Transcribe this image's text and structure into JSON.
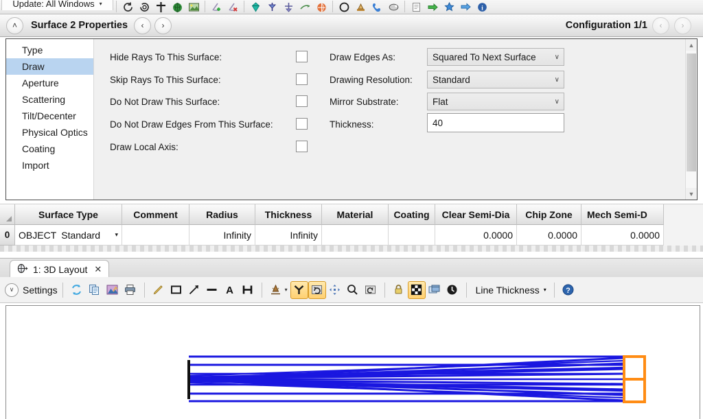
{
  "top_toolbar": {
    "update_label": "Update: All Windows",
    "caret": "▾",
    "icons": [
      "refresh-clockwise-icon",
      "refresh-counter-icon",
      "crosshair-icon",
      "globe-icon",
      "image-icon",
      "insert-surface-icon",
      "delete-surface-icon",
      "gem-icon",
      "fold-mirror-icon",
      "coordinate-break-icon",
      "ray-aim-icon",
      "color-globe-icon",
      "lens-catalog-icon",
      "tolerance-icon",
      "phone-icon",
      "ellipse-icon",
      "report-icon",
      "green-arrow-icon",
      "blue-star-icon",
      "blue-arrow-icon",
      "help-info-icon"
    ]
  },
  "prop_header": {
    "collapse_icon": "˄",
    "title": "Surface   2 Properties",
    "prev_icon": "‹",
    "next_icon": "›",
    "config_label": "Configuration 1/1"
  },
  "categories": {
    "items": [
      {
        "label": "Type",
        "active": false
      },
      {
        "label": "Draw",
        "active": true
      },
      {
        "label": "Aperture",
        "active": false
      },
      {
        "label": "Scattering",
        "active": false
      },
      {
        "label": "Tilt/Decenter",
        "active": false
      },
      {
        "label": "Physical Optics",
        "active": false
      },
      {
        "label": "Coating",
        "active": false
      },
      {
        "label": "Import",
        "active": false
      }
    ]
  },
  "draw_form": {
    "checkboxes": [
      {
        "label": "Hide Rays To This Surface:",
        "checked": false
      },
      {
        "label": "Skip Rays To This Surface:",
        "checked": false
      },
      {
        "label": "Do Not Draw This Surface:",
        "checked": false
      },
      {
        "label": "Do Not Draw Edges From This Surface:",
        "checked": false
      },
      {
        "label": "Draw Local Axis:",
        "checked": false
      }
    ],
    "fields": [
      {
        "label": "Draw Edges As:",
        "value": "Squared To Next Surface",
        "kind": "dropdown"
      },
      {
        "label": "Drawing Resolution:",
        "value": "Standard",
        "kind": "dropdown"
      },
      {
        "label": "Mirror Substrate:",
        "value": "Flat",
        "kind": "dropdown"
      },
      {
        "label": "Thickness:",
        "value": "40",
        "kind": "text"
      }
    ],
    "chevron": "∨"
  },
  "scrollbar": {
    "up_icon": "▲",
    "down_icon": "▼"
  },
  "sheet": {
    "columns": [
      {
        "label": "Surface Type",
        "width": 156
      },
      {
        "label": "Comment",
        "width": 98
      },
      {
        "label": "Radius",
        "width": 96
      },
      {
        "label": "Thickness",
        "width": 97
      },
      {
        "label": "Material",
        "width": 97
      },
      {
        "label": "Coating",
        "width": 68
      },
      {
        "label": "Clear Semi-Dia",
        "width": 119
      },
      {
        "label": "Chip Zone",
        "width": 94
      },
      {
        "label": "Mech Semi-D",
        "width": 120
      }
    ],
    "row": {
      "index": "0",
      "surface_prefix": "OBJECT",
      "surface_type": "Standard",
      "caret": "▾",
      "comment": "",
      "radius": "Infinity",
      "thickness": "Infinity",
      "material": "",
      "coating": "",
      "clear_semi_dia": "0.0000",
      "chip_zone": "0.0000",
      "mech_semi_dia": "0.0000"
    }
  },
  "window_tab": {
    "label": "1: 3D Layout",
    "close_icon": "✕",
    "icon": "lens-3d-icon"
  },
  "layout_toolbar": {
    "settings_label": "Settings",
    "settings_caret": "∨",
    "line_thickness_label": "Line Thickness",
    "line_thickness_caret": "▾",
    "icons": [
      {
        "name": "refresh-icon",
        "active": false
      },
      {
        "name": "copy-icon",
        "active": false
      },
      {
        "name": "save-image-icon",
        "active": false
      },
      {
        "name": "print-icon",
        "active": false
      },
      {
        "name": "pencil-icon",
        "active": false
      },
      {
        "name": "rectangle-icon",
        "active": false
      },
      {
        "name": "arrow-icon",
        "active": false
      },
      {
        "name": "line-icon",
        "active": false
      },
      {
        "name": "text-tool-icon",
        "active": false
      },
      {
        "name": "dimension-icon",
        "active": false
      },
      {
        "name": "annotation-dropdown-icon",
        "active": false
      },
      {
        "name": "axis-3d-icon",
        "active": true
      },
      {
        "name": "rotate-icon",
        "active": true
      },
      {
        "name": "pan-icon",
        "active": false
      },
      {
        "name": "zoom-icon",
        "active": false
      },
      {
        "name": "reset-view-icon",
        "active": false
      },
      {
        "name": "lock-icon",
        "active": false
      },
      {
        "name": "fit-window-icon",
        "active": true
      },
      {
        "name": "window-layers-icon",
        "active": false
      },
      {
        "name": "clock-icon",
        "active": false
      },
      {
        "name": "help-icon",
        "active": false
      }
    ]
  },
  "plot": {
    "ray_color": "#1a17e0",
    "detector_color": "#ff8c14",
    "object_line_color": "#111111",
    "background": "#ffffff"
  }
}
